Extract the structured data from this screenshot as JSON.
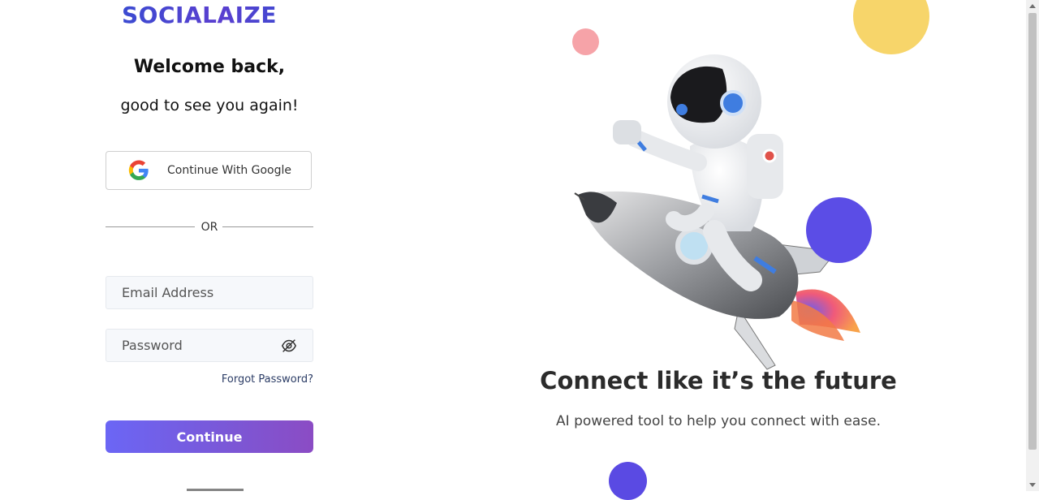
{
  "brand": {
    "logo_text": "SOCIALAIZE"
  },
  "login": {
    "welcome": "Welcome back,",
    "subtitle": "good to see you again!",
    "google_button": "Continue With Google",
    "divider": "OR",
    "email_placeholder": "Email Address",
    "password_placeholder": "Password",
    "forgot_password": "Forgot Password?",
    "continue_button": "Continue"
  },
  "hero": {
    "tagline": "Connect like it’s the future",
    "subtag": "AI powered tool to help you connect with ease."
  },
  "colors": {
    "brand_gradient": [
      "#3b4bd1",
      "#5a3fd0"
    ],
    "button_gradient": [
      "#6b66f5",
      "#8b4cc4"
    ],
    "accent_purple": "#5b4de6",
    "accent_yellow": "#f7d56a",
    "accent_pink": "#f6a3a8"
  },
  "icons": [
    "google-icon",
    "eye-off-icon",
    "astronaut-rocket-illustration"
  ]
}
